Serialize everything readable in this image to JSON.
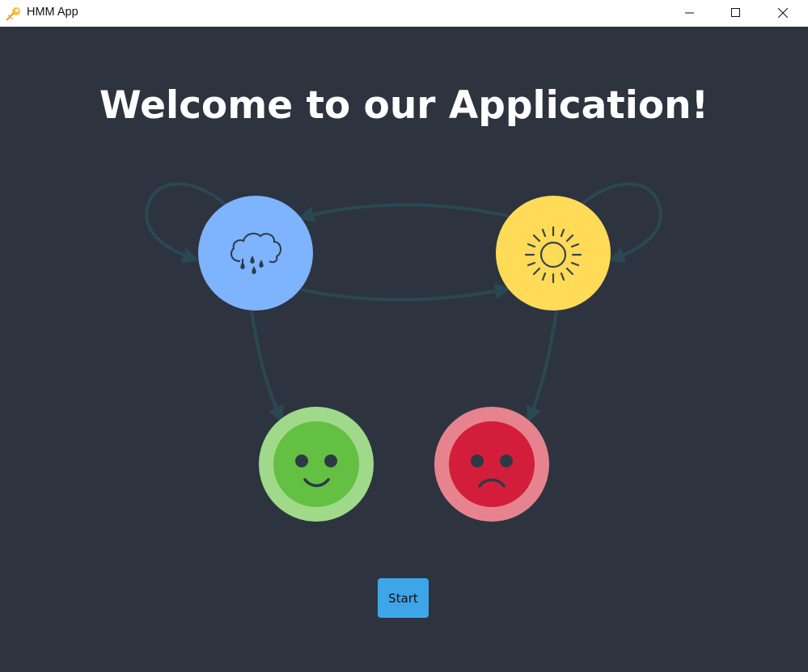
{
  "window": {
    "title": "HMM App",
    "icon": "app-logo-icon",
    "controls": [
      "minimize-icon",
      "maximize-icon",
      "close-icon"
    ]
  },
  "main": {
    "welcome_text": "Welcome to our Application!",
    "start_label": "Start"
  },
  "diagram": {
    "states": [
      {
        "name": "rainy",
        "icon": "rain-cloud-icon",
        "color": "#7eb3fd"
      },
      {
        "name": "sunny",
        "icon": "sun-icon",
        "color": "#ffdb58"
      }
    ],
    "observations": [
      {
        "name": "happy",
        "icon": "happy-face-icon",
        "outer_color": "#a0d98a",
        "inner_color": "#64c043"
      },
      {
        "name": "sad",
        "icon": "sad-face-icon",
        "outer_color": "#e7838f",
        "inner_color": "#d21e3b"
      }
    ],
    "arrow_color": "#2a4854"
  },
  "colors": {
    "background": "#2d343f",
    "button": "#3ea6e8",
    "title_text": "#ffffff"
  }
}
